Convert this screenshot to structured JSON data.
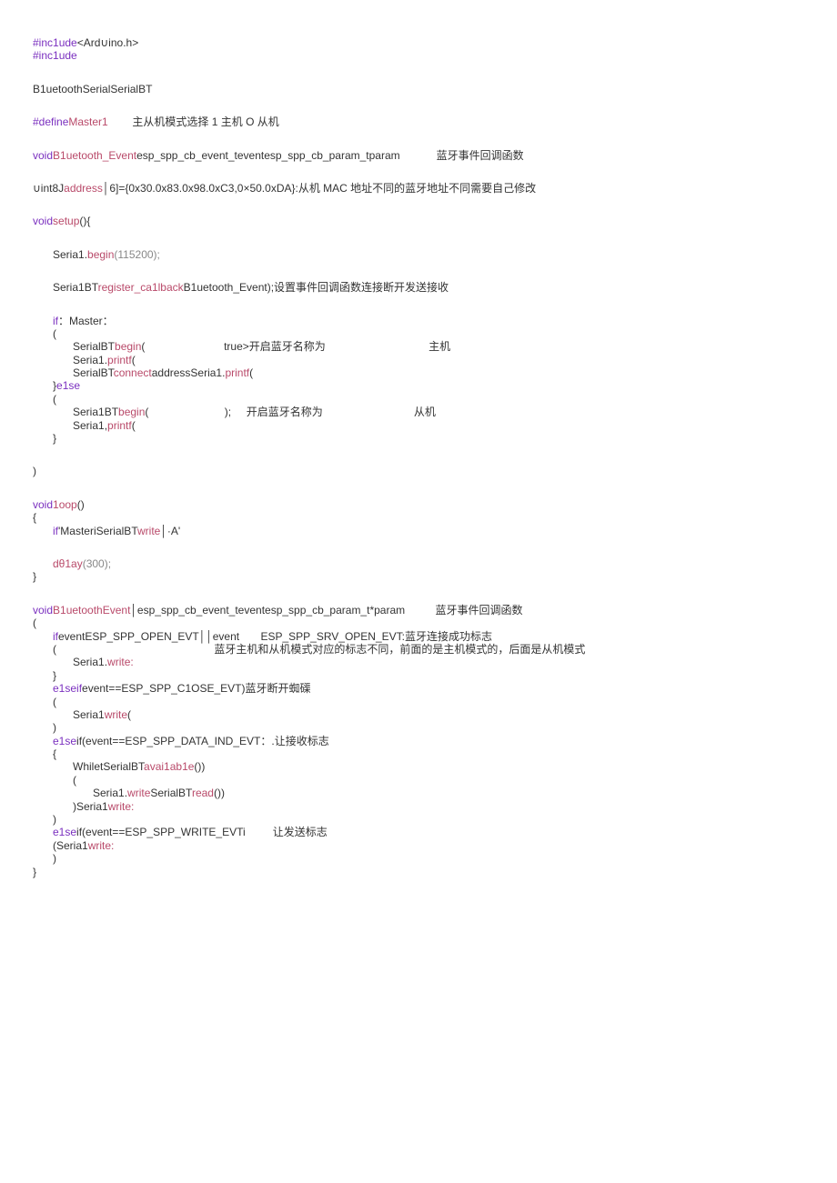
{
  "code": {
    "line1_a": "#inc1ude",
    "line1_b": "<Ard∪ino.h>",
    "line2": "#inc1ude",
    "line3": "B1uetoothSerialSerialBT",
    "line4_a": "#define",
    "line4_b": "Master1",
    "line4_c": "主从机模式选择 1 主机 O 从机",
    "line5_a": "void",
    "line5_b": "B1uetooth_Event",
    "line5_c": "esp_spp_cb_event_teventesp_spp_cb_param_tparam",
    "line5_d": "蓝牙事件回调函数",
    "line6_a": "∪int8J",
    "line6_b": "address",
    "line6_c": "│6]={0x30.0x83.0x98.0xC3,0×50.0xDA}:",
    "line6_d": "从机 MAC 地址不同的蓝牙地址不同需要自己修改",
    "line7_a": "void",
    "line7_b": "setup",
    "line7_c": "(){",
    "line8_a": "Seria1.",
    "line8_b": "begin",
    "line8_c": "(115200);",
    "line9_a": "Seria1BT",
    "line9_b": "register_ca1lback",
    "line9_c": "B1uetooth_Event);",
    "line9_d": "设置事件回调函数连接断开发送接收",
    "line10_a": "if",
    "line10_b": "：Master：",
    "line11": "(",
    "line12_a": "SerialBT",
    "line12_b": "begin",
    "line12_c": "(",
    "line12_d": "true>",
    "line12_e": "开启蓝牙名称为",
    "line12_f": "主机",
    "line13_a": "Seria1.",
    "line13_b": "printf",
    "line13_c": "(",
    "line14_a": "SerialBT",
    "line14_b": "connect",
    "line14_c": "addressSeria1.",
    "line14_d": "printf",
    "line14_e": "(",
    "line15_a": "}",
    "line15_b": "e1se",
    "line16": "(",
    "line17_a": "Seria1BT",
    "line17_b": "begin",
    "line17_c": "(",
    "line17_d": ");",
    "line17_e": "开启蓝牙名称为",
    "line17_f": "从机",
    "line18_a": "Seria1,",
    "line18_b": "printf",
    "line18_c": "(",
    "line19": "}",
    "line20": ")",
    "line21_a": "void",
    "line21_b": "1oop",
    "line21_c": "()",
    "line22": "{",
    "line23_a": "if",
    "line23_b": "'MasteriSerialBT",
    "line23_c": "write",
    "line23_d": "│·A'",
    "line24_a": "dθ1ay",
    "line24_b": "(300);",
    "line25": "}",
    "line26_a": "void",
    "line26_b": "B1uetoothEvent",
    "line26_c": "│esp_spp_cb_event_teventesp_spp_cb_param_t*param",
    "line26_d": "蓝牙事件回调函数",
    "line27": "(",
    "line28_a": "if",
    "line28_b": "eventESP_SPP_OPEN_EVT││event",
    "line28_c": "ESP_SPP_SRV_OPEN_EVT:",
    "line28_d": "蓝牙连接成功标志",
    "line29_a": "(",
    "line29_b": "蓝牙主机和从机模式对应的标志不同，前面的是主机模式的，后面是从机模式",
    "line30_a": "Seria1.",
    "line30_b": "write:",
    "line31": "}",
    "line32_a": "e1se",
    "line32_b": "if",
    "line32_c": "event==ESP_SPP_C1OSE_EVT)",
    "line32_d": "蓝牙断开蜘磲",
    "line33": "(",
    "line34_a": "Seria1",
    "line34_b": "write",
    "line34_c": "(",
    "line35": ")",
    "line36_a": "e1se",
    "line36_b": "if(event==ESP_SPP_DATA_IND_EVT：",
    "line36_c": ".让接收标志",
    "line37": "{",
    "line38_a": "Whilet",
    "line38_b": "SerialBT",
    "line38_c": "avai1ab1e",
    "line38_d": "())",
    "line39": "(",
    "line40_a": "Seria1.",
    "line40_b": "write",
    "line40_c": "SerialBT",
    "line40_d": "read",
    "line40_e": "())",
    "line41_a": ")",
    "line41_b": "Seria1",
    "line41_c": "write:",
    "line42": ")",
    "line43_a": "e1se",
    "line43_b": "if(event==ESP_SPP_WRITE_EVTi",
    "line43_c": "让发送标志",
    "line44_a": "(",
    "line44_b": "Seria1",
    "line44_c": "write:",
    "line45": ")",
    "line46": "}"
  }
}
